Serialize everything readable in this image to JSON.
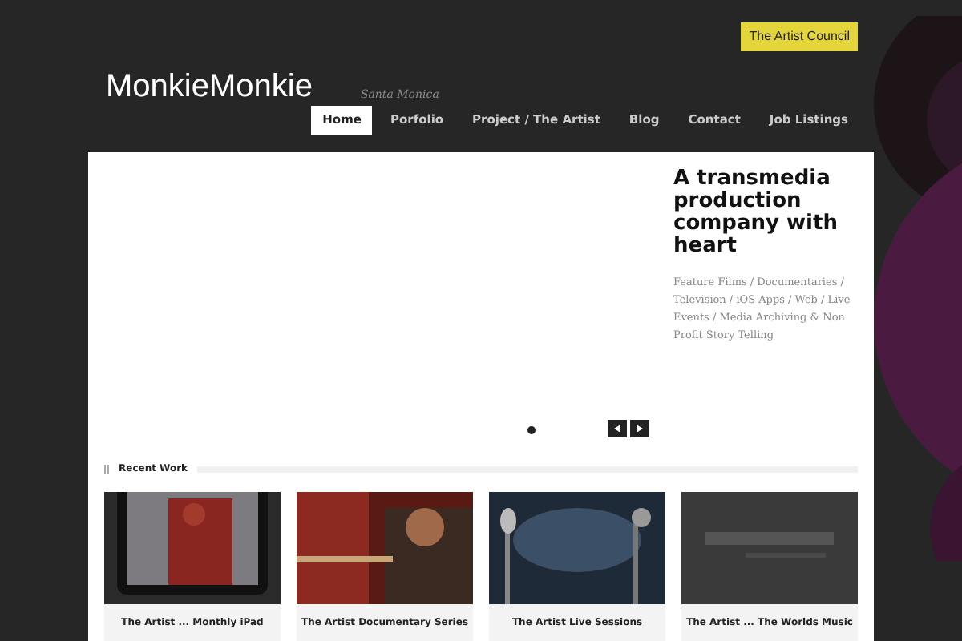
{
  "top_button": "The Artist Council",
  "logo": "MonkieMonkie",
  "tagline": "Santa Monica",
  "nav": [
    {
      "label": "Home",
      "selected": true
    },
    {
      "label": "Porfolio",
      "selected": false
    },
    {
      "label": "Project / The Artist",
      "selected": false
    },
    {
      "label": "Blog",
      "selected": false
    },
    {
      "label": "Contact",
      "selected": false
    },
    {
      "label": "Job Listings",
      "selected": false
    }
  ],
  "slider": {
    "heading": "A transmedia production company with heart",
    "text": "Feature Films / Documentaries / Television / iOS Apps / Web / Live Events / Media Archiving & Non Profit Story Telling",
    "dots": [
      {
        "selected": true
      }
    ]
  },
  "recent_work": {
    "title": "Recent Work",
    "items": [
      {
        "caption": "The Artist ... Monthly iPad"
      },
      {
        "caption": "The Artist Documentary Series"
      },
      {
        "caption": "The Artist Live Sessions"
      },
      {
        "caption": "The Artist ... The Worlds Music"
      }
    ]
  }
}
